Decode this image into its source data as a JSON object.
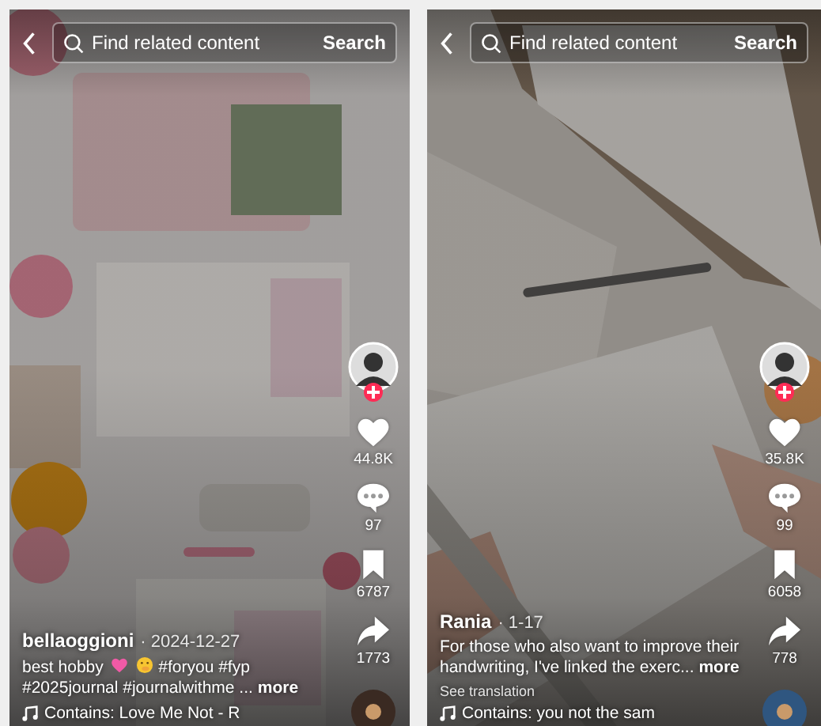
{
  "screens": [
    {
      "search": {
        "placeholder": "Find related content",
        "button": "Search"
      },
      "actions": [
        {
          "kind": "like",
          "count": "44.8K"
        },
        {
          "kind": "comment",
          "count": "97"
        },
        {
          "kind": "save",
          "count": "6787"
        },
        {
          "kind": "share",
          "count": "1773"
        }
      ],
      "author": "bellaoggioni",
      "date": "· 2024-12-27",
      "caption": [
        {
          "kind": "text",
          "text": "best hobby"
        },
        {
          "kind": "heart-emoji"
        },
        {
          "kind": "face-emoji"
        },
        {
          "kind": "text",
          "text": "#foryou #fyp #2025journal #journalwithme ..."
        }
      ],
      "more": "more",
      "music": "Contains: Love Me Not - R"
    },
    {
      "search": {
        "placeholder": "Find related content",
        "button": "Search"
      },
      "actions": [
        {
          "kind": "like",
          "count": "35.8K"
        },
        {
          "kind": "comment",
          "count": "99"
        },
        {
          "kind": "save",
          "count": "6058"
        },
        {
          "kind": "share",
          "count": "778"
        }
      ],
      "author": "Rania",
      "date": "· 1-17",
      "caption": [
        {
          "kind": "text",
          "text": "For those who also want to improve their handwriting, I've linked the exerc..."
        }
      ],
      "more": "more",
      "translation": "See translation",
      "music": "Contains: you not the sam"
    }
  ]
}
